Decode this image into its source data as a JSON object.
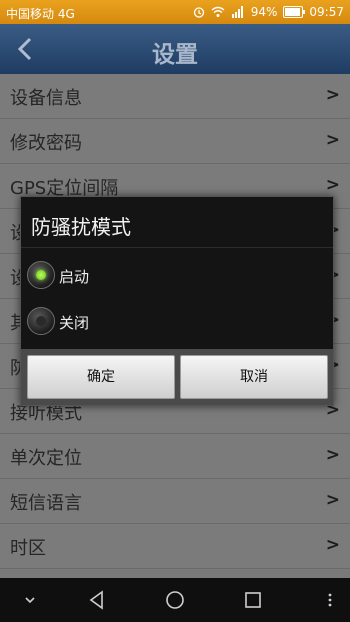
{
  "status_bar": {
    "carrier": "中国移动 4G",
    "battery": "94%",
    "battery_level": 0.94,
    "time": "09:57",
    "icons": [
      "alarm-icon",
      "wifi-icon",
      "signal-4g-icon",
      "battery-icon"
    ],
    "color": "#e39a18"
  },
  "header": {
    "title": "设置",
    "back_icon": "back-arrow-icon",
    "color": "#2b4a72"
  },
  "list": {
    "items": [
      {
        "label": "设备信息"
      },
      {
        "label": "修改密码"
      },
      {
        "label": "GPS定位间隔"
      },
      {
        "label": "设"
      },
      {
        "label": "设"
      },
      {
        "label": "其"
      },
      {
        "label": "防"
      },
      {
        "label": "接听模式"
      },
      {
        "label": "单次定位"
      },
      {
        "label": "短信语言"
      },
      {
        "label": "时区"
      }
    ],
    "chevron": ">"
  },
  "dialog": {
    "title": "防骚扰模式",
    "options": [
      {
        "label": "启动",
        "selected": true
      },
      {
        "label": "关闭",
        "selected": false
      }
    ],
    "confirm_label": "确定",
    "cancel_label": "取消",
    "accent": "#8fe23b"
  },
  "nav_bar": {
    "icons": [
      "collapse-icon",
      "back-icon",
      "home-icon",
      "recent-apps-icon",
      "more-icon"
    ]
  }
}
